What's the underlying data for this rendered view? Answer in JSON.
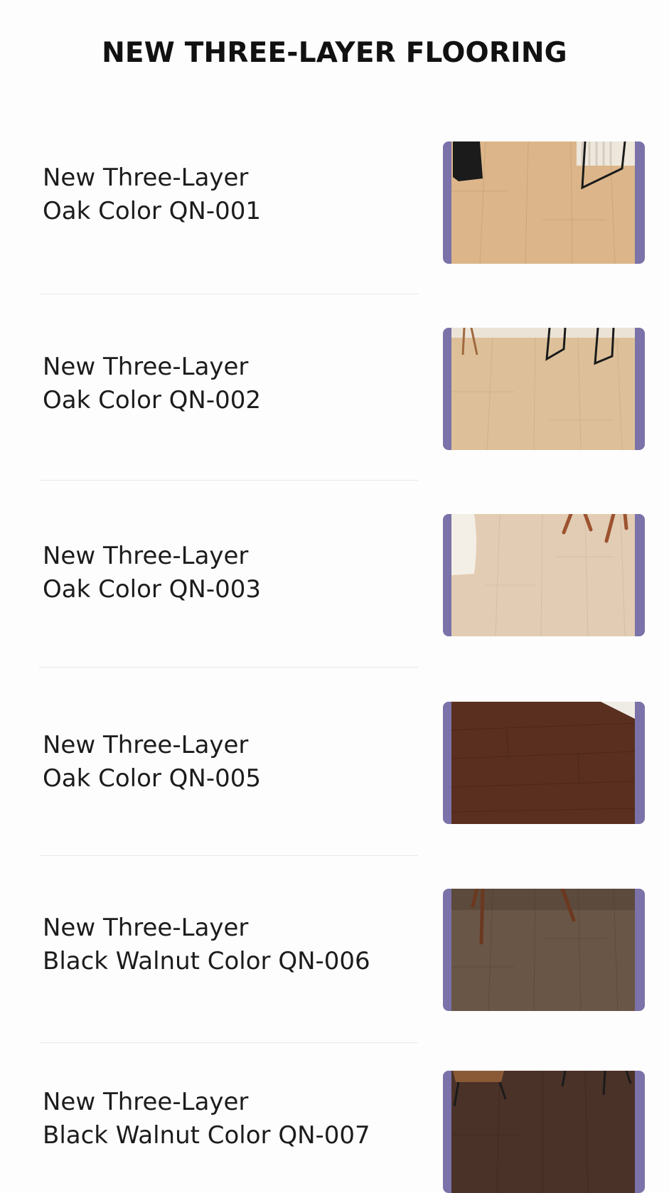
{
  "header": {
    "title": "NEW THREE-LAYER FLOORING"
  },
  "products": [
    {
      "line1": "New Three-Layer",
      "line2": "Oak Color QN-001",
      "image_icon": "floor-sample-image",
      "floor_color": "#dcb68a",
      "grain_color": "#c9a374"
    },
    {
      "line1": "New Three-Layer",
      "line2": "Oak Color QN-002",
      "image_icon": "floor-sample-image",
      "floor_color": "#ddc09a",
      "grain_color": "#cdae85"
    },
    {
      "line1": "New Three-Layer",
      "line2": "Oak Color QN-003",
      "image_icon": "floor-sample-image",
      "floor_color": "#e2ccb3",
      "grain_color": "#d4bda2"
    },
    {
      "line1": "New Three-Layer",
      "line2": "Oak Color QN-005",
      "image_icon": "floor-sample-image",
      "floor_color": "#5a2f20",
      "grain_color": "#4b261a"
    },
    {
      "line1": "New Three-Layer",
      "line2": "Black Walnut Color QN-006",
      "image_icon": "floor-sample-image",
      "floor_color": "#6a5646",
      "grain_color": "#5c4a3c"
    },
    {
      "line1": "New Three-Layer",
      "line2": "Black Walnut Color QN-007",
      "image_icon": "floor-sample-image",
      "floor_color": "#4a3228",
      "grain_color": "#3e2a21"
    }
  ],
  "colors": {
    "thumb_frame": "#7a72a8",
    "divider": "#e8e8e8",
    "background": "#fdfdfd"
  }
}
